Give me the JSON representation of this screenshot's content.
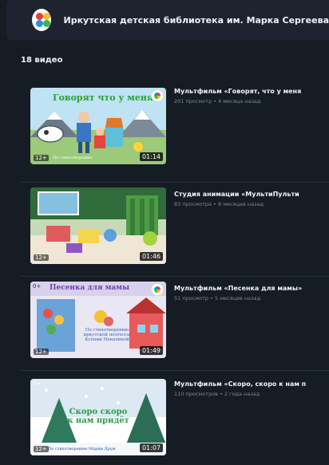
{
  "channel": {
    "name": "Иркутская детская библиотека им. Марка Сергеева"
  },
  "videos_count": "18 видео",
  "videos": [
    {
      "title": "Мультфильм «Говорят, что у меня",
      "meta": "201 просмотр • 4 месяца назад",
      "duration": "01:14",
      "age": "12+",
      "thumb_text": "Говорят что у меня",
      "thumb_caption": "По стихотворению"
    },
    {
      "title": "Студия анимации «МультиПульти",
      "meta": "83 просмотра • 8 месяцев назад",
      "duration": "01:46",
      "age": "12+"
    },
    {
      "title": "Мультфильм «Песенка для мамы»",
      "meta": "51 просмотр • 5 месяцев назад",
      "duration": "01:49",
      "age": "12+",
      "age_top": "0+",
      "thumb_text": "Песенка для мамы",
      "thumb_caption": "По стихотворению иркутской поэтессы Ксении Невалиной"
    },
    {
      "title": "Мультфильм «Скоро, скоро к нам п",
      "meta": "110 просмотров • 2 года назад",
      "duration": "01:07",
      "age": "12+",
      "age_top": "0+",
      "thumb_text": "Скоро скоро к нам придёт",
      "thumb_caption": "По стихотворению Марии Друм"
    }
  ],
  "colors": {
    "background": "#161c24",
    "header": "#1d2430",
    "meta_text": "#7d8794"
  }
}
